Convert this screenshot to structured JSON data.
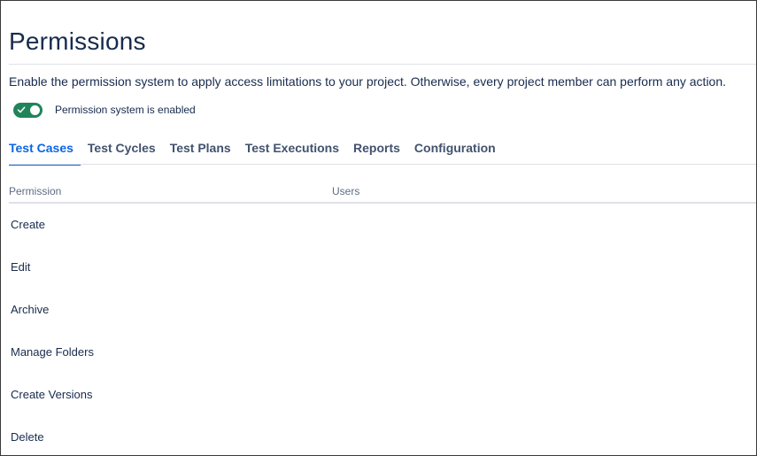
{
  "page": {
    "title": "Permissions",
    "description": "Enable the permission system to apply access limitations to your project. Otherwise, every project member can perform any action."
  },
  "permission_toggle": {
    "label": "Permission system is enabled",
    "enabled": true,
    "color": "#1f845a"
  },
  "tabs": [
    {
      "label": "Test Cases",
      "active": true
    },
    {
      "label": "Test Cycles",
      "active": false
    },
    {
      "label": "Test Plans",
      "active": false
    },
    {
      "label": "Test Executions",
      "active": false
    },
    {
      "label": "Reports",
      "active": false
    },
    {
      "label": "Configuration",
      "active": false
    }
  ],
  "table": {
    "columns": {
      "permission": "Permission",
      "users": "Users"
    },
    "rows": [
      {
        "permission": "Create",
        "users": ""
      },
      {
        "permission": "Edit",
        "users": ""
      },
      {
        "permission": "Archive",
        "users": ""
      },
      {
        "permission": "Manage Folders",
        "users": ""
      },
      {
        "permission": "Create Versions",
        "users": ""
      },
      {
        "permission": "Delete",
        "users": ""
      }
    ]
  },
  "colors": {
    "accent": "#0c66e4",
    "title": "#172b4d",
    "tab_inactive": "#42526e",
    "toggle_on": "#1f845a"
  }
}
